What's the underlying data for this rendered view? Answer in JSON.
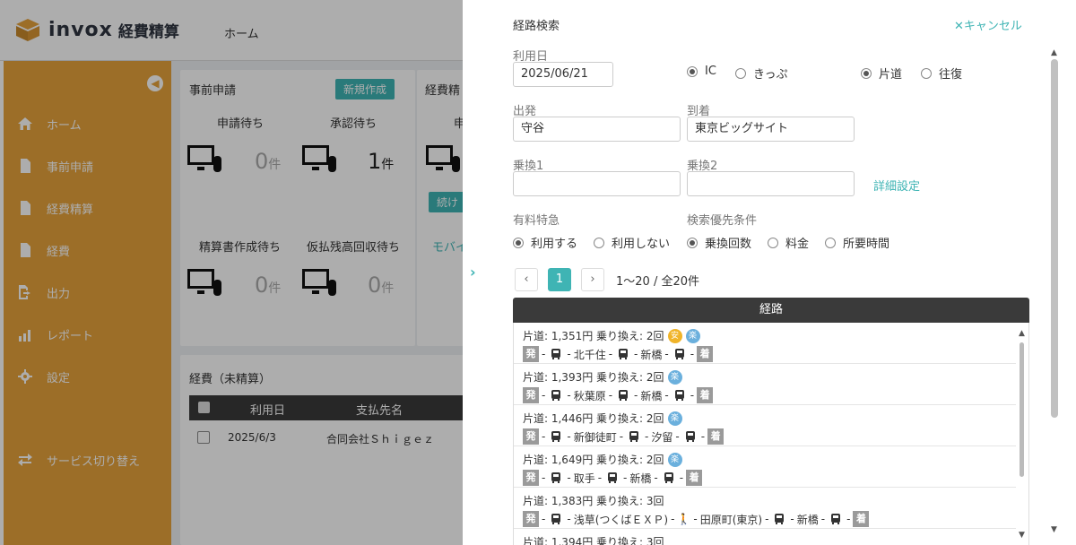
{
  "header": {
    "app_name": "invox",
    "app_sub": "経費精算",
    "home": "ホーム"
  },
  "sidebar": {
    "items": [
      {
        "label": "ホーム",
        "icon": "home-icon"
      },
      {
        "label": "事前申請",
        "icon": "document-icon"
      },
      {
        "label": "経費精算",
        "icon": "document-icon"
      },
      {
        "label": "経費",
        "icon": "document-icon"
      },
      {
        "label": "出力",
        "icon": "export-icon"
      },
      {
        "label": "レポート",
        "icon": "report-icon"
      },
      {
        "label": "設定",
        "icon": "gear-icon"
      },
      {
        "label": "サービス切り替え",
        "icon": "switch-icon"
      }
    ]
  },
  "dashboard": {
    "prior_title": "事前申請",
    "new_button": "新規作成",
    "expense_title": "経費精",
    "waiting_apply": "申請待ち",
    "waiting_approve": "承認待ち",
    "count_apply": "0",
    "count_approve": "1",
    "unit": "件",
    "waiting_doc": "精算書作成待ち",
    "waiting_advance": "仮払残高回収待ち",
    "count_doc": "0",
    "count_advance": "0",
    "right_label1": "申",
    "right_btn": "続け",
    "right_link": "モバイ",
    "list_title": "経費（未精算）",
    "col_date": "利用日",
    "col_payee": "支払先名",
    "row_date": "2025/6/3",
    "row_payee": "合同会社Ｓｈｉｇｅｚ"
  },
  "panel": {
    "title": "経路検索",
    "cancel": "キャンセル",
    "date_label": "利用日",
    "date_value": "2025/06/21",
    "ic": "IC",
    "kippu": "きっぷ",
    "oneway": "片道",
    "roundtrip": "往復",
    "from_label": "出発",
    "from_value": "守谷",
    "to_label": "到着",
    "to_value": "東京ビッグサイト",
    "via1_label": "乗換1",
    "via2_label": "乗換2",
    "detail_link": "詳細設定",
    "express_label": "有料特急",
    "express_use": "利用する",
    "express_nouse": "利用しない",
    "priority_label": "検索優先条件",
    "prio_transfer": "乗換回数",
    "prio_fare": "料金",
    "prio_time": "所要時間",
    "page": "1",
    "page_info": "1〜20 / 全20件",
    "route_header": "経路"
  },
  "routes": [
    {
      "summary": "片道: 1,351円  乗り換え: 2回",
      "badges": [
        "安",
        "楽"
      ],
      "stations": [
        "北千住",
        "新橋"
      ]
    },
    {
      "summary": "片道: 1,393円  乗り換え: 2回",
      "badges": [
        "楽"
      ],
      "stations": [
        "秋葉原",
        "新橋"
      ]
    },
    {
      "summary": "片道: 1,446円  乗り換え: 2回",
      "badges": [
        "楽"
      ],
      "stations": [
        "新御徒町",
        "汐留"
      ]
    },
    {
      "summary": "片道: 1,649円  乗り換え: 2回",
      "badges": [
        "楽"
      ],
      "stations": [
        "取手",
        "新橋"
      ]
    },
    {
      "summary": "片道: 1,383円  乗り換え: 3回",
      "badges": [],
      "stations": [
        "浅草(つくばＥＸＰ)",
        "田原町(東京)",
        "新橋"
      ]
    },
    {
      "summary": "片道: 1,394円  乗り換え: 3回",
      "badges": [],
      "stations": []
    }
  ],
  "route_tags": {
    "start": "発",
    "end": "着"
  },
  "colors": {
    "accent": "#3fb4b4",
    "sidebar": "#e6a23c",
    "header_dark": "#3a3a3a"
  }
}
